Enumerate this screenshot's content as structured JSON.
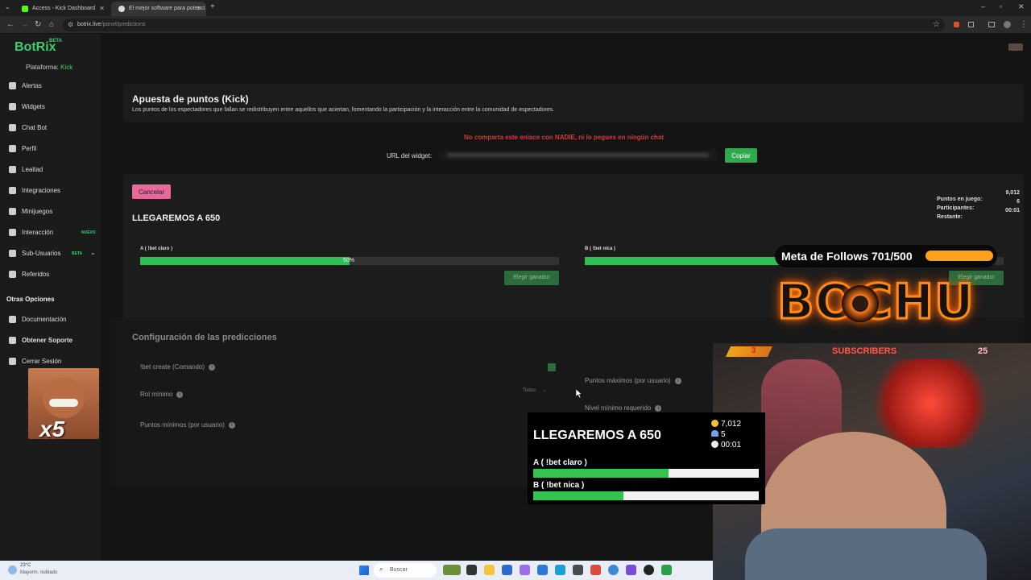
{
  "browser": {
    "tabs": [
      {
        "label": "Access - Kick Dashboard",
        "color": "#53fc18"
      },
      {
        "label": "El mejor software para potenci",
        "color": "#dddddd"
      }
    ],
    "url_host": "botrix.live",
    "url_path": "/panel/predictions"
  },
  "sidebar": {
    "brand": "BotRix",
    "brand_badge": "BETA",
    "platform_label": "Plataforma:",
    "platform_value": "Kick",
    "items": [
      {
        "label": "Alertas",
        "icon": "bell-icon"
      },
      {
        "label": "Widgets",
        "icon": "grid-icon"
      },
      {
        "label": "Chat Bot",
        "icon": "chat-icon"
      },
      {
        "label": "Perfil",
        "icon": "profile-icon"
      },
      {
        "label": "Lealtad",
        "icon": "trophy-icon"
      },
      {
        "label": "Integraciones",
        "icon": "plug-icon"
      },
      {
        "label": "Minijuegos",
        "icon": "gamepad-icon"
      },
      {
        "label": "Interacción",
        "icon": "music-icon",
        "badge": "NUEVO"
      },
      {
        "label": "Sub-Usuarios",
        "icon": "users-icon",
        "badge": "BETA"
      },
      {
        "label": "Referidos",
        "icon": "referral-icon"
      }
    ],
    "other_heading": "Otras Opciones",
    "other_items": [
      {
        "label": "Documentación",
        "icon": "doc-icon"
      },
      {
        "label": "Obtener Soporte",
        "icon": "support-icon"
      },
      {
        "label": "Cerrar Sesión",
        "icon": "logout-icon"
      }
    ]
  },
  "header_card": {
    "title": "Apuesta de puntos (Kick)",
    "description": "Los puntos de los espectadores que fallan se redistribuyen entre aquellos que aciertan, fomentando la participación y la interacción entre la comunidad de espectadores.",
    "warning": "No comparta este enlace con NADIE, ni lo pegues en ningún chat",
    "widget_url_label": "URL del widget:",
    "copy_button": "Copiar"
  },
  "prediction": {
    "cancel_button": "Cancelar",
    "title": "LLEGAREMOS A 650",
    "stats": [
      {
        "label": "Puntos en juego:",
        "value": "9,012"
      },
      {
        "label": "Participantes:",
        "value": "6"
      },
      {
        "label": "Restante:",
        "value": "00:01"
      }
    ],
    "option_a": {
      "label": "A ( !bet claro )",
      "percent_text": "50%",
      "fill": 0.5,
      "button": "Elegir ganador"
    },
    "option_b": {
      "label": "B ( !bet nica )",
      "fill": 0.5,
      "button": "Elegir ganador"
    }
  },
  "config": {
    "title": "Configuración de las predicciones",
    "fields_left": [
      {
        "label": "!bet create (Comando)"
      },
      {
        "label": "Rol mínimo",
        "select_value": "Todos"
      },
      {
        "label": "Puntos mínimos (por usuario)"
      }
    ],
    "fields_right": [
      {
        "label": "Puntos máximos (por usuario)"
      },
      {
        "label": "Nivel mínimo requerido"
      }
    ]
  },
  "overlay": {
    "follows_text": "Meta de Follows 701/500",
    "follows_fill": 1.0,
    "brand_text": "BOCHU",
    "subs_label": "SUBSCRIBERS",
    "subs_left": "3",
    "subs_count": "25",
    "emote_text": "x5",
    "pred_title": "LLEGAREMOS A 650",
    "pred_points": "7,012",
    "pred_users": "5",
    "pred_time": "00:01",
    "pred_a": "A ( !bet claro )",
    "pred_a_fill": 0.6,
    "pred_b": "B ( !bet nica )",
    "pred_b_fill": 0.4
  },
  "taskbar": {
    "weather_temp": "23°C",
    "weather_desc": "Mayorm. nublado",
    "search_placeholder": "Buscar"
  }
}
